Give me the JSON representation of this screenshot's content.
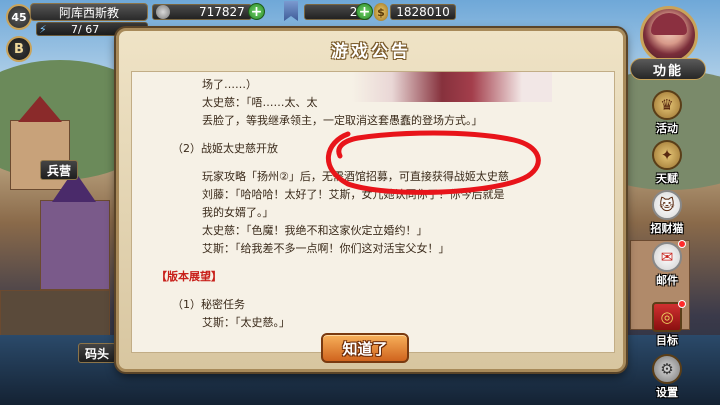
{
  "hud": {
    "level": "45",
    "b_badge": "B",
    "player_name": "阿库西斯教",
    "stamina": "7/ 67",
    "gold": "717827",
    "gems": "20",
    "money": "1828010"
  },
  "map_labels": {
    "barracks": "兵营",
    "dock": "码头"
  },
  "side_menu": {
    "function_label": "功能",
    "items": [
      {
        "label": "活动",
        "icon": "crown-icon"
      },
      {
        "label": "天赋",
        "icon": "wings-icon"
      },
      {
        "label": "招财猫",
        "icon": "lucky-cat-icon"
      },
      {
        "label": "邮件",
        "icon": "mail-icon"
      },
      {
        "label": "目标",
        "icon": "target-icon"
      },
      {
        "label": "设置",
        "icon": "gear-icon"
      }
    ]
  },
  "dialog": {
    "title": "游戏公告",
    "lines": {
      "l1": "场了……）",
      "l2": "太史慈：「唔……太、太",
      "l3": "丢脸了，等我继承领主，一定取消这套愚蠢的登场方式。」",
      "l4": "（2）战姬太史慈开放",
      "l5": "玩家攻略「扬州②」后，无需酒馆招募，可直接获得战姬太史慈",
      "l6": "刘藤：「哈哈哈！太好了！艾斯，女儿她认同你了！你今后就是",
      "l7": "我的女婿了。」",
      "l8": "太史慈：「色魔！我绝不和这家伙定立婚约！」",
      "l9": "艾斯：「给我差不多一点啊！你们这对活宝父女！」",
      "l10": "【版本展望】",
      "l11": "（1）秘密任务",
      "l12": "艾斯：「太史慈。」"
    },
    "ok_button": "知道了"
  },
  "colors": {
    "accent_red": "#c8201a",
    "annotation_red": "#e8141a",
    "button_orange": "#e07a2a"
  }
}
